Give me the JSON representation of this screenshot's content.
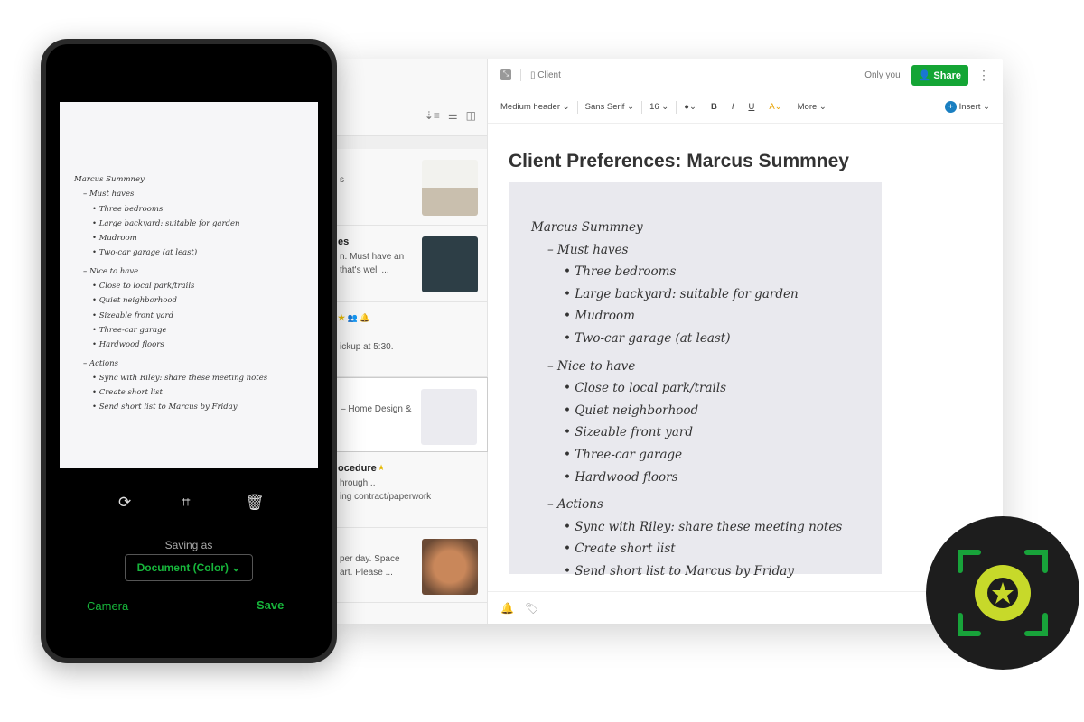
{
  "app": {
    "breadcrumb": "Client",
    "visibility": "Only you",
    "share_label": "Share"
  },
  "toolbar": {
    "style": "Medium header",
    "font": "Sans Serif",
    "size": "16",
    "more": "More",
    "insert": "Insert"
  },
  "note": {
    "title": "Client Preferences: Marcus Summney",
    "handwriting": [
      "Marcus Summney",
      "– Must haves",
      "• Three bedrooms",
      "• Large backyard: suitable for garden",
      "• Mudroom",
      "• Two-car garage (at least)",
      "– Nice to have",
      "• Close to local park/trails",
      "• Quiet neighborhood",
      "• Sizeable front yard",
      "• Three-car garage",
      "• Hardwood floors",
      "– Actions",
      "• Sync with Riley: share these meeting notes",
      "• Create short list",
      "• Send short list to Marcus by Friday"
    ]
  },
  "note_list": [
    {
      "title": "",
      "l1": "s",
      "l2": "",
      "thumb": "living-room-photo"
    },
    {
      "title": "es",
      "l1": "n. Must have an",
      "l2": "that's well ...",
      "thumb": "kitchen-photo"
    },
    {
      "title": "",
      "l1": "",
      "l2": "ickup at 5:30.",
      "icons": [
        "star",
        "shared",
        "reminder"
      ]
    },
    {
      "title": "",
      "l1": "– Home Design &",
      "l2": "",
      "thumb": "handwritten-note",
      "selected": true
    },
    {
      "title": "ocedure",
      "l1": "hrough...",
      "l2": "ing contract/paperwork",
      "icons": [
        "star",
        "shared"
      ]
    },
    {
      "title": "",
      "l1": "per day. Space",
      "l2": "art. Please ...",
      "thumb": "dog-photo"
    }
  ],
  "phone": {
    "saving_as": "Saving as",
    "mode": "Document (Color)",
    "camera": "Camera",
    "save": "Save"
  },
  "colors": {
    "green": "#14a535",
    "lime": "#c7d92a",
    "badge": "#1d1d1d"
  }
}
